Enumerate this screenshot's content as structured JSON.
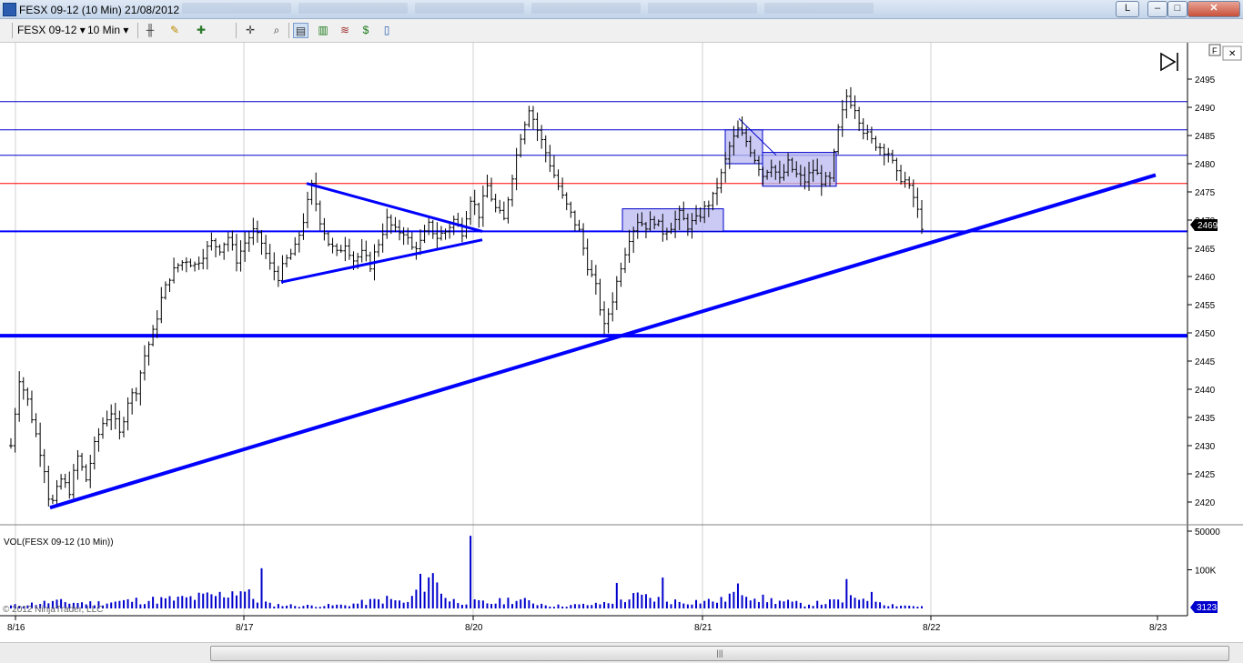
{
  "window": {
    "title": "FESX 09-12 (10 Min)  21/08/2012",
    "link_button": "L",
    "minimize": "–",
    "maximize": "□",
    "close": "✕"
  },
  "toolbar": {
    "instrument": "FESX 09-12",
    "instrument_arrow": "▾",
    "interval": "10 Min",
    "interval_arrow": "▾",
    "icons": [
      "bar-style-icon",
      "pencil-draw-icon",
      "zoom-in-icon",
      "crosshair-icon",
      "zoom-icon",
      "chart-trader-icon",
      "strategy-icon",
      "indicator-icon",
      "dollar-icon",
      "properties-icon"
    ]
  },
  "chart": {
    "flag_button": "F",
    "close_button": "✕",
    "panel_toggle": "▷",
    "copyright": "© 2012 NinjaTrader, LLC",
    "price_scale": {
      "min": 2420,
      "max": 2495,
      "step": 5,
      "ticks": [
        "2420",
        "2425",
        "2430",
        "2435",
        "2440",
        "2445",
        "2450",
        "2455",
        "2460",
        "2465",
        "2470",
        "2475",
        "2480",
        "2485",
        "2490",
        "2495"
      ]
    },
    "last_price": "2469",
    "volume_label": "VOL(FESX 09-12 (10 Min))",
    "volume_ticks": [
      "100K",
      "50000"
    ],
    "last_volume": "3123",
    "dates": [
      "8/16",
      "8/17",
      "8/20",
      "8/21",
      "8/22",
      "8/23"
    ],
    "colors": {
      "bars": "#000000",
      "volume": "#0000cc",
      "drawing": "#0000ff",
      "resistance": "#ff0000",
      "box_fill": "#b8b8f0",
      "grid": "#d0d0d0",
      "price_marker": "#0000cc"
    }
  },
  "chart_data": {
    "type": "ohlc",
    "price_axis": {
      "min": 2420,
      "max": 2495
    },
    "volume_axis": {
      "ticks": [
        50000,
        100000
      ]
    },
    "categories": [
      "8/16",
      "8/17",
      "8/20",
      "8/21",
      "8/22",
      "8/23"
    ],
    "horizontal_lines": [
      {
        "price": 2491,
        "color": "#0000cc",
        "width": "thin"
      },
      {
        "price": 2486,
        "color": "#0000cc",
        "width": "thin"
      },
      {
        "price": 2481.5,
        "color": "#0000cc",
        "width": "thin"
      },
      {
        "price": 2476.5,
        "color": "#ff0000",
        "width": "thin"
      },
      {
        "price": 2468,
        "color": "#0000ff",
        "width": "medium"
      },
      {
        "price": 2449.5,
        "color": "#0000ff",
        "width": "thick"
      }
    ],
    "trendlines": [
      {
        "from": [
          "8/16 ~10:00",
          2419
        ],
        "to": [
          "8/23",
          2478
        ]
      },
      {
        "from": [
          "8/17 ~11:30",
          2476.5
        ],
        "to": [
          "8/17 ~17:00",
          2468
        ]
      },
      {
        "from": [
          "8/17 ~10:00",
          2459
        ],
        "to": [
          "8/17 ~17:00",
          2466.5
        ]
      }
    ],
    "boxes": [
      {
        "price_low": 2468,
        "price_high": 2472,
        "period": "8/20 afternoon"
      },
      {
        "price_low": 2480,
        "price_high": 2486,
        "period": "8/21 morning"
      },
      {
        "price_low": 2476,
        "price_high": 2482,
        "period": "8/21 midday"
      }
    ],
    "last_price": 2469,
    "last_volume": 3123,
    "series_close_path": [
      [
        0,
        2430
      ],
      [
        2,
        2442
      ],
      [
        4,
        2438
      ],
      [
        6,
        2432
      ],
      [
        8,
        2426
      ],
      [
        9,
        2421
      ],
      [
        10,
        2420
      ],
      [
        12,
        2424
      ],
      [
        14,
        2422
      ],
      [
        16,
        2428
      ],
      [
        18,
        2424
      ],
      [
        20,
        2430
      ],
      [
        22,
        2434
      ],
      [
        24,
        2436
      ],
      [
        26,
        2432
      ],
      [
        28,
        2438
      ],
      [
        30,
        2440
      ],
      [
        32,
        2446
      ],
      [
        34,
        2450
      ],
      [
        36,
        2456
      ],
      [
        38,
        2460
      ],
      [
        40,
        2462
      ],
      [
        42,
        2463
      ],
      [
        44,
        2462
      ],
      [
        46,
        2464
      ],
      [
        48,
        2466
      ],
      [
        50,
        2465
      ],
      [
        52,
        2467
      ],
      [
        54,
        2463
      ],
      [
        56,
        2466
      ],
      [
        58,
        2468
      ],
      [
        60,
        2466
      ],
      [
        62,
        2462
      ],
      [
        64,
        2460
      ],
      [
        66,
        2463
      ],
      [
        68,
        2465
      ],
      [
        70,
        2470
      ],
      [
        72,
        2476
      ],
      [
        74,
        2470
      ],
      [
        76,
        2466
      ],
      [
        78,
        2464
      ],
      [
        80,
        2466
      ],
      [
        82,
        2463
      ],
      [
        84,
        2464
      ],
      [
        86,
        2462
      ],
      [
        88,
        2466
      ],
      [
        90,
        2470
      ],
      [
        92,
        2468
      ],
      [
        94,
        2468
      ],
      [
        96,
        2465
      ],
      [
        98,
        2466
      ],
      [
        100,
        2469
      ],
      [
        102,
        2467
      ],
      [
        104,
        2468
      ],
      [
        106,
        2470
      ],
      [
        108,
        2468
      ],
      [
        110,
        2474
      ],
      [
        112,
        2471
      ],
      [
        114,
        2476
      ],
      [
        116,
        2472
      ],
      [
        118,
        2470
      ],
      [
        120,
        2478
      ],
      [
        122,
        2485
      ],
      [
        124,
        2490
      ],
      [
        126,
        2486
      ],
      [
        128,
        2482
      ],
      [
        130,
        2478
      ],
      [
        132,
        2474
      ],
      [
        134,
        2471
      ],
      [
        136,
        2468
      ],
      [
        138,
        2462
      ],
      [
        140,
        2458
      ],
      [
        142,
        2451
      ],
      [
        144,
        2456
      ],
      [
        146,
        2462
      ],
      [
        148,
        2467
      ],
      [
        150,
        2470
      ],
      [
        152,
        2469
      ],
      [
        154,
        2470
      ],
      [
        156,
        2468
      ],
      [
        158,
        2469
      ],
      [
        160,
        2471
      ],
      [
        162,
        2469
      ],
      [
        164,
        2470
      ],
      [
        166,
        2472
      ],
      [
        168,
        2474
      ],
      [
        170,
        2478
      ],
      [
        172,
        2483
      ],
      [
        174,
        2486
      ],
      [
        176,
        2484
      ],
      [
        178,
        2481
      ],
      [
        180,
        2478
      ],
      [
        182,
        2480
      ],
      [
        184,
        2477
      ],
      [
        186,
        2480
      ],
      [
        188,
        2478
      ],
      [
        190,
        2477
      ],
      [
        192,
        2479
      ],
      [
        194,
        2477
      ],
      [
        196,
        2477
      ],
      [
        198,
        2486
      ],
      [
        200,
        2492
      ],
      [
        202,
        2490
      ],
      [
        204,
        2486
      ],
      [
        206,
        2484
      ],
      [
        208,
        2483
      ],
      [
        210,
        2482
      ],
      [
        212,
        2478
      ],
      [
        214,
        2477
      ],
      [
        216,
        2474
      ],
      [
        218,
        2469
      ]
    ],
    "volume_path": [
      [
        0,
        4
      ],
      [
        10,
        10
      ],
      [
        20,
        8
      ],
      [
        30,
        12
      ],
      [
        40,
        14
      ],
      [
        50,
        20
      ],
      [
        55,
        30
      ],
      [
        58,
        16
      ],
      [
        62,
        6
      ],
      [
        70,
        4
      ],
      [
        80,
        5
      ],
      [
        90,
        14
      ],
      [
        95,
        8
      ],
      [
        100,
        55
      ],
      [
        105,
        12
      ],
      [
        110,
        10
      ],
      [
        115,
        8
      ],
      [
        120,
        14
      ],
      [
        130,
        4
      ],
      [
        140,
        6
      ],
      [
        150,
        18
      ],
      [
        160,
        10
      ],
      [
        170,
        12
      ],
      [
        175,
        30
      ],
      [
        180,
        14
      ],
      [
        190,
        6
      ],
      [
        200,
        12
      ],
      [
        205,
        20
      ],
      [
        210,
        6
      ],
      [
        218,
        3
      ]
    ]
  }
}
